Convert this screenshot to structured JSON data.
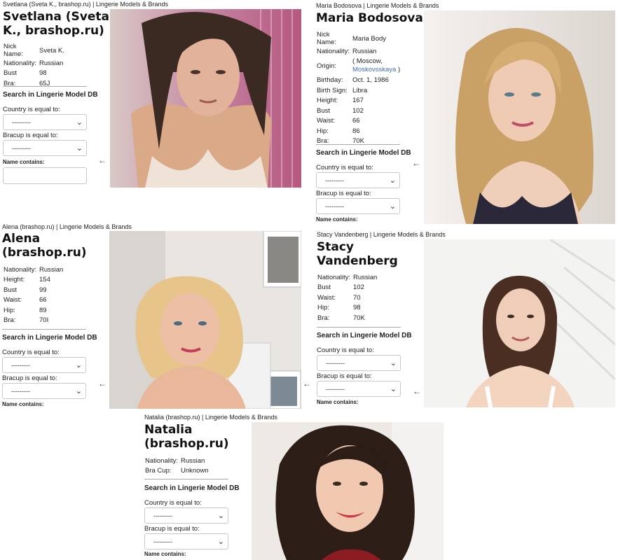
{
  "common": {
    "search_title": "Search in Lingerie Model DB",
    "country_label": "Country is equal to:",
    "bracup_label": "Bracup is equal to:",
    "name_label": "Name contains:",
    "select_value": "---------",
    "arrow": "←"
  },
  "models": [
    {
      "header": "Svetlana (Sveta K., brashop.ru) | Lingerie Models & Brands",
      "name_line1": "Svetlana (Sveta",
      "name_line2": "K., brashop.ru)",
      "facts": [
        {
          "key": "Nick Name:",
          "value": "Sveta K."
        },
        {
          "key": "Nationality:",
          "value": "Russian"
        },
        {
          "key": "Bust",
          "value": "98"
        },
        {
          "key": "Bra:",
          "value": "65J"
        }
      ]
    },
    {
      "header": "Maria Bodosova | Lingerie Models & Brands",
      "name_line1": "Maria Bodosova",
      "facts": [
        {
          "key": "Nick Name:",
          "value": "Maria Body"
        },
        {
          "key": "Nationality:",
          "value": "Russian"
        },
        {
          "key": "Origin:",
          "value_prefix": "( Moscow,",
          "value_link": "Moskovsskaya",
          "value_suffix": " )"
        },
        {
          "key": "Birthday:",
          "value": "Oct. 1, 1986"
        },
        {
          "key": "Birth Sign:",
          "value": "Libra"
        },
        {
          "key": "Height:",
          "value": "167"
        },
        {
          "key": "Bust",
          "value": "102"
        },
        {
          "key": "Waist:",
          "value": "66"
        },
        {
          "key": "Hip:",
          "value": "86"
        },
        {
          "key": "Bra:",
          "value": "70K"
        }
      ]
    },
    {
      "header": "Alena (brashop.ru) | Lingerie Models & Brands",
      "name_line1": "Alena",
      "name_line2": "(brashop.ru)",
      "facts": [
        {
          "key": "Nationality:",
          "value": "Russian"
        },
        {
          "key": "Height:",
          "value": "154"
        },
        {
          "key": "Bust",
          "value": "99"
        },
        {
          "key": "Waist:",
          "value": "66"
        },
        {
          "key": "Hip:",
          "value": "89"
        },
        {
          "key": "Bra:",
          "value": "70I"
        }
      ]
    },
    {
      "header": "Stacy Vandenberg | Lingerie Models & Brands",
      "name_line1": "Stacy",
      "name_line2": "Vandenberg",
      "facts": [
        {
          "key": "Nationality:",
          "value": "Russian"
        },
        {
          "key": "Bust",
          "value": "102"
        },
        {
          "key": "Waist:",
          "value": "70"
        },
        {
          "key": "Hip:",
          "value": "98"
        },
        {
          "key": "Bra:",
          "value": "70K"
        }
      ]
    },
    {
      "header": "Natalia (brashop.ru) | Lingerie Models & Brands",
      "name_line1": "Natalia",
      "name_line2": "(brashop.ru)",
      "facts": [
        {
          "key": "Nationality:",
          "value": "Russian"
        },
        {
          "key": "Bra Cup:",
          "value": "Unknown"
        }
      ]
    }
  ],
  "colors": {
    "link": "#3a6fb0",
    "bra_value": "#2e8b2e"
  }
}
